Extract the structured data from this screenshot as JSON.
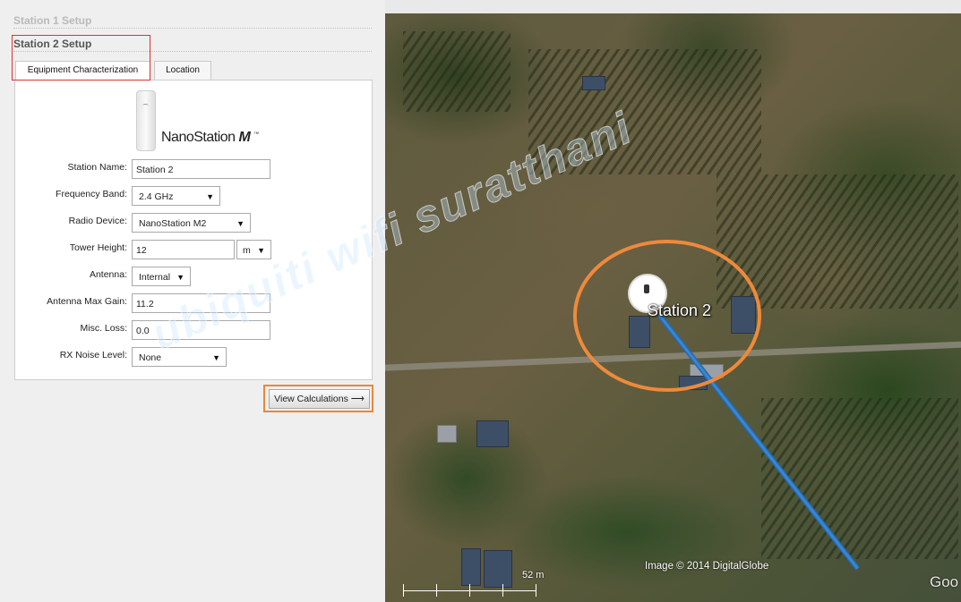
{
  "sections": {
    "station1_title": "Station 1 Setup",
    "station2_title": "Station 2 Setup"
  },
  "tabs": [
    {
      "label": "Equipment Characterization",
      "active": true
    },
    {
      "label": "Location",
      "active": false
    }
  ],
  "device": {
    "brand_text": "NanoStation",
    "brand_suffix": "M",
    "trademark": "™"
  },
  "form": {
    "station_name": {
      "label": "Station Name:",
      "value": "Station 2"
    },
    "frequency_band": {
      "label": "Frequency Band:",
      "value": "2.4 GHz"
    },
    "radio_device": {
      "label": "Radio Device:",
      "value": "NanoStation M2"
    },
    "tower_height": {
      "label": "Tower Height:",
      "value": "12",
      "unit": "m"
    },
    "antenna": {
      "label": "Antenna:",
      "value": "Internal"
    },
    "antenna_max_gain": {
      "label": "Antenna Max Gain:",
      "value": "11.2"
    },
    "misc_loss": {
      "label": "Misc. Loss:",
      "value": "0.0"
    },
    "rx_noise_level": {
      "label": "RX Noise Level:",
      "value": "None"
    }
  },
  "actions": {
    "view_calculations": "View Calculations ⟶"
  },
  "map": {
    "station_label": "Station 2",
    "copyright": "Image © 2014 DigitalGlobe",
    "scale": "52 m",
    "provider": "Goo",
    "link_color": "#2f7fd0"
  },
  "watermark": "ubiquiti wifi suratthani",
  "colors": {
    "highlight_red": "#d9342b",
    "highlight_orange": "#e8873b"
  }
}
